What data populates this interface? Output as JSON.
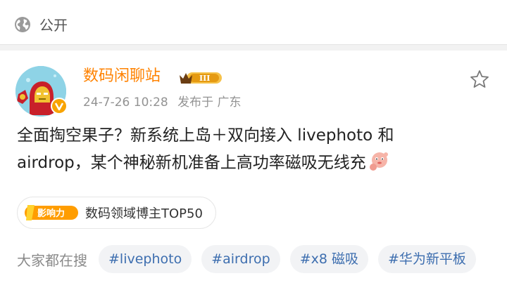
{
  "header": {
    "visibility_label": "公开",
    "visibility_icon": "globe-icon"
  },
  "post": {
    "author": {
      "name": "数码闲聊站",
      "level_badge": "III",
      "verified": true,
      "name_color": "#ff8200"
    },
    "timestamp": "24-7-26 10:28",
    "location_text": "发布于 广东",
    "text_line1": "全面掏空果子？新系统上岛＋双向接入 livephoto 和",
    "text_line2": "airdrop，某个神秘新机准备上高功率磁吸无线充",
    "emoji_icon": "thinking-emoji-icon",
    "influence": {
      "logo_text": "影响力",
      "label": "数码领域博主TOP50"
    },
    "search": {
      "prefix": "大家都在搜",
      "tags": [
        "#livephoto",
        "#airdrop",
        "#x8 磁吸",
        "#华为新平板"
      ]
    }
  },
  "colors": {
    "link": "#3d6eaf",
    "accent": "#ff8200"
  }
}
